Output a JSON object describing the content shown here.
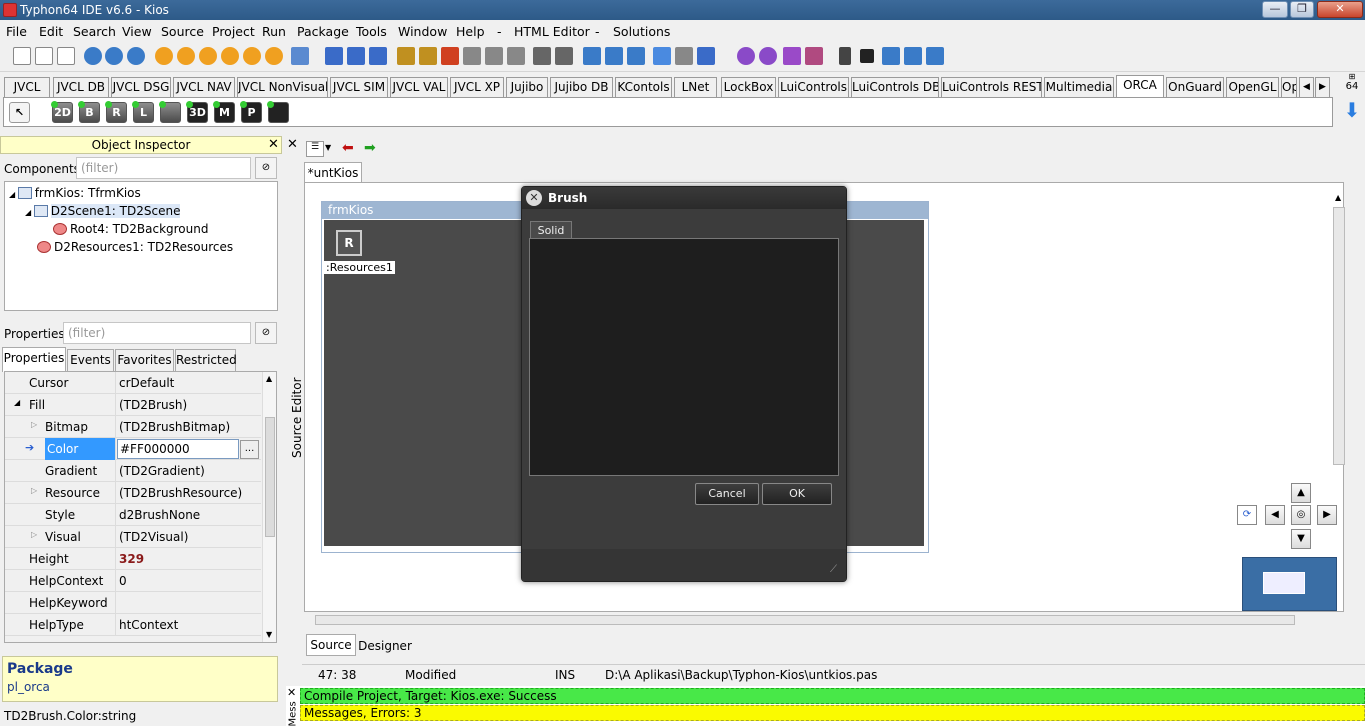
{
  "window": {
    "title": "Typhon64 IDE v6.6 - Kios",
    "controls": [
      "—",
      "❐",
      "✕"
    ]
  },
  "menu": [
    "File",
    "Edit",
    "Search",
    "View",
    "Source",
    "Project",
    "Run",
    "Package",
    "Tools",
    "Window",
    "Help",
    "-",
    "HTML Editor",
    "-",
    "Solutions"
  ],
  "palette_tabs": [
    "JVCL",
    "JVCL DB",
    "JVCL DSG",
    "JVCL NAV",
    "JVCL NonVisual",
    "JVCL SIM",
    "JVCL VAL",
    "JVCL XP",
    "Jujibo",
    "Jujibo DB",
    "KContols",
    "LNet",
    "LockBox",
    "LuiControls",
    "LuiControls DB",
    "LuiControls REST",
    "Multimedia",
    "ORCA",
    "OnGuard",
    "OpenGL",
    "Op"
  ],
  "palette_selected": "ORCA",
  "palette_components": [
    "2D",
    "B",
    "R",
    "L",
    "",
    "3D",
    "M",
    "P",
    ""
  ],
  "badge_64": "64",
  "object_inspector": {
    "title": "Object Inspector",
    "components_label": "Components",
    "components_filter_placeholder": "(filter)",
    "tree": [
      {
        "label": "frmKios: TfrmKios",
        "level": 0
      },
      {
        "label": "D2Scene1: TD2Scene",
        "level": 1
      },
      {
        "label": "Root4: TD2Background",
        "level": 2
      },
      {
        "label": "D2Resources1: TD2Resources",
        "level": 1
      }
    ],
    "properties_label": "Properties",
    "properties_filter_placeholder": "(filter)",
    "tabs": [
      "Properties",
      "Events",
      "Favorites",
      "Restricted"
    ],
    "rows": [
      {
        "name": "Cursor",
        "value": "crDefault"
      },
      {
        "name": "Fill",
        "value": "(TD2Brush)"
      },
      {
        "name": "Bitmap",
        "value": "(TD2BrushBitmap)"
      },
      {
        "name": "Color",
        "value": "#FF000000"
      },
      {
        "name": "Gradient",
        "value": "(TD2Gradient)"
      },
      {
        "name": "Resource",
        "value": "(TD2BrushResource)"
      },
      {
        "name": "Style",
        "value": "d2BrushNone"
      },
      {
        "name": "Visual",
        "value": "(TD2Visual)"
      },
      {
        "name": "Height",
        "value": "329"
      },
      {
        "name": "HelpContext",
        "value": "0"
      },
      {
        "name": "HelpKeyword",
        "value": ""
      },
      {
        "name": "HelpType",
        "value": "htContext"
      }
    ],
    "ellipsis": "...",
    "package_heading": "Package",
    "package_name": "pl_orca",
    "hint": "TD2Brush.Color:string"
  },
  "source_editor_label": "Source Editor",
  "editor": {
    "tab": "*untKios",
    "form_caption": "frmKios",
    "resource_icon": "R",
    "resource_label": ":Resources1",
    "bottom_tabs": [
      "Source",
      "Designer"
    ]
  },
  "brush_dialog": {
    "title": "Brush",
    "tab": "Solid",
    "cancel": "Cancel",
    "ok": "OK"
  },
  "status": {
    "position": "47: 38",
    "state": "Modified",
    "mode": "INS",
    "path": "D:\\A Aplikasi\\Backup\\Typhon-Kios\\untkios.pas"
  },
  "messages": {
    "label": "Mess",
    "line1": "Compile Project, Target: Kios.exe: Success",
    "line2": "Messages, Errors: 3"
  },
  "colors": {
    "title_bar": "#2d5a88",
    "inspector_header": "#ffffc8",
    "selected_row": "#3399ff",
    "success": "#48e848",
    "warning": "#fafa00",
    "dialog": "#3c3c3c"
  }
}
